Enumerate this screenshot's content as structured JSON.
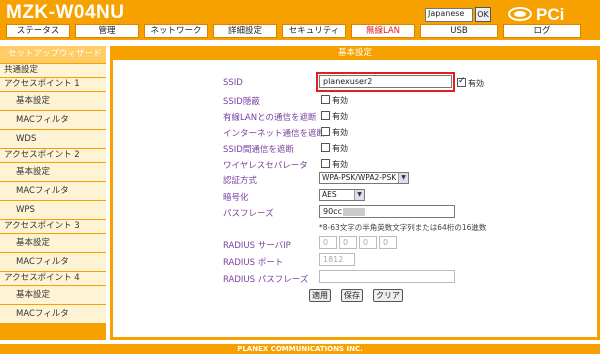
{
  "header": {
    "model": "MZK-W04NU",
    "lang_selected": "Japanese",
    "ok_label": "OK",
    "logo_text": "PCi"
  },
  "nav": [
    "ステータス",
    "管理",
    "ネットワーク",
    "詳細設定",
    "セキュリティ",
    "無線LAN",
    "USB",
    "ログ"
  ],
  "sidebar": {
    "title": "セットアップウィザード",
    "items": [
      "共通設定",
      "アクセスポイント 1",
      "基本設定",
      "MACフィルタ",
      "WDS",
      "アクセスポイント 2",
      "基本設定",
      "MACフィルタ",
      "WPS",
      "アクセスポイント 3",
      "基本設定",
      "MACフィルタ",
      "アクセスポイント 4",
      "基本設定",
      "MACフィルタ"
    ]
  },
  "main": {
    "title": "基本設定",
    "ssid_label": "SSID",
    "ssid_value": "planexuser2",
    "enabled_label": "有効",
    "rows": [
      "SSID隠蔽",
      "有線LANとの通信を遮断",
      "インターネット通信を遮断",
      "SSID間通信を遮断",
      "ワイヤレスセパレータ"
    ],
    "auth_label": "認証方式",
    "auth_value": "WPA-PSK/WPA2-PSK",
    "enc_label": "暗号化",
    "enc_value": "AES",
    "pass_label": "パスフレーズ",
    "pass_value": "90cc",
    "pass_hint": "*8-63文字の半角英数文字列または64桁の16進数",
    "radius_ip_label": "RADIUS サーバIP",
    "radius_ip": [
      "0",
      "0",
      "0",
      "0"
    ],
    "radius_port_label": "RADIUS ポート",
    "radius_port": "1812",
    "radius_pass_label": "RADIUS パスフレーズ",
    "buttons": [
      "適用",
      "保存",
      "クリア"
    ]
  },
  "footer": "PLANEX COMMUNICATIONS INC.",
  "colors": {
    "accent": "#f7a100",
    "label": "#7a3fa0",
    "highlight": "#e02020"
  }
}
